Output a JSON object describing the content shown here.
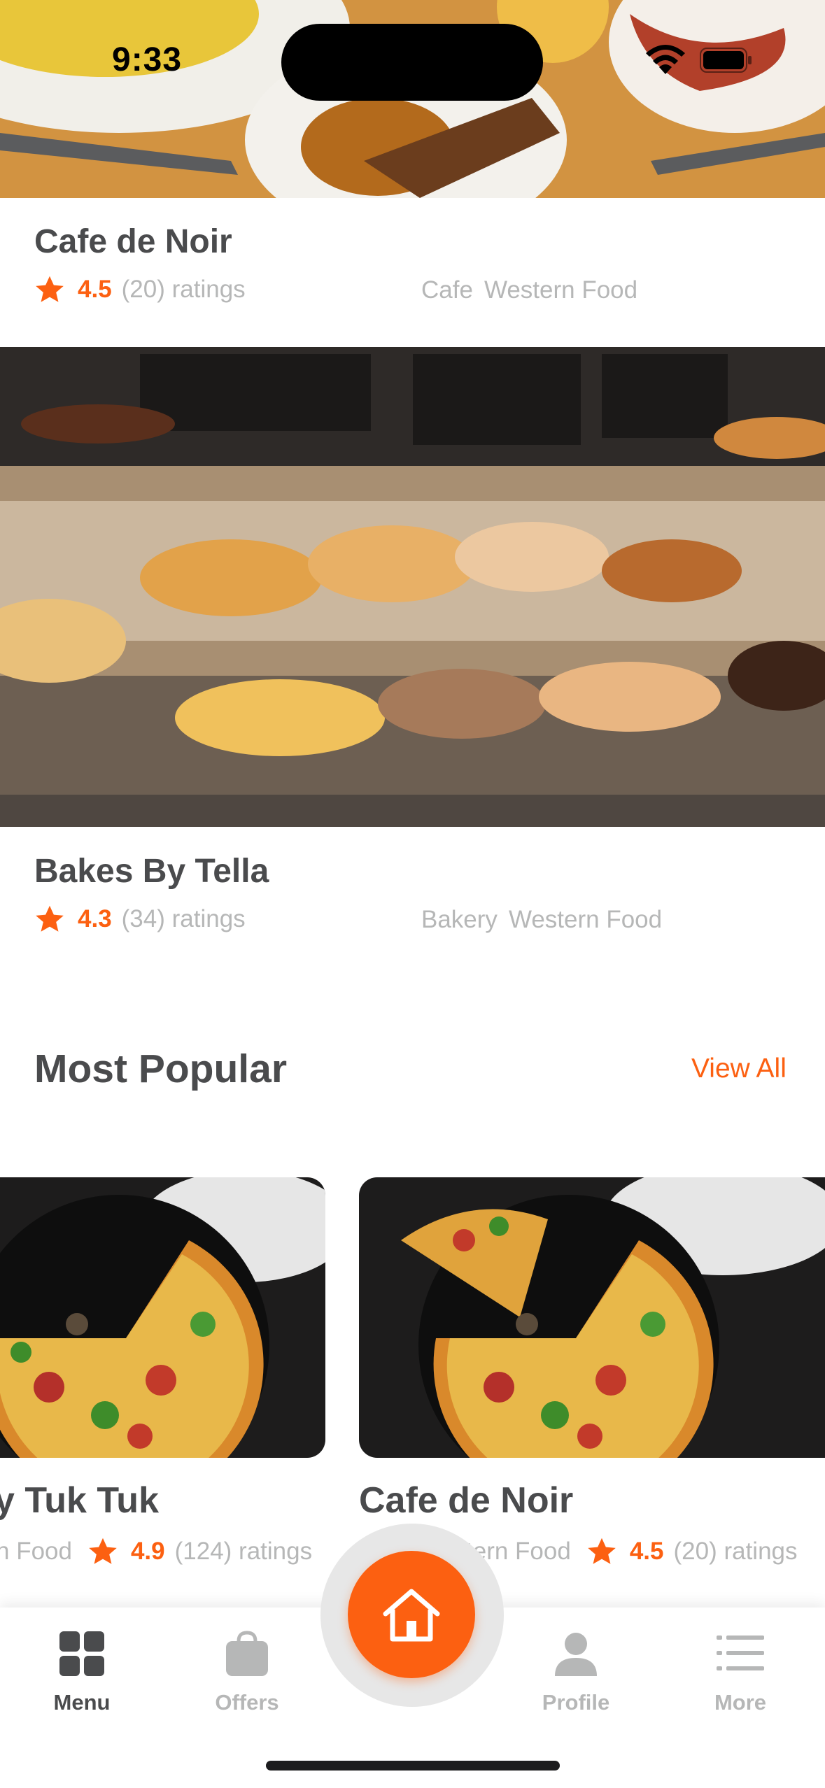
{
  "status_bar": {
    "time": "9:33"
  },
  "restaurants": [
    {
      "name": "Cafe de Noir",
      "rating": "4.5",
      "rating_count": "(20) ratings",
      "categories": [
        "Cafe",
        "Western Food"
      ]
    },
    {
      "name": "Bakes By Tella",
      "rating": "4.3",
      "rating_count": "(34) ratings",
      "categories": [
        "Bakery",
        "Western Food"
      ]
    }
  ],
  "most_popular": {
    "title": "Most Popular",
    "view_all": "View All",
    "items": [
      {
        "name": "y Tuk Tuk",
        "category": "n Food",
        "rating": "4.9",
        "rating_count": "(124) ratings"
      },
      {
        "name": "Cafe de Noir",
        "category": "Cafe  Western Food",
        "rating": "4.5",
        "rating_count": "(20) ratings"
      }
    ]
  },
  "tabbar": {
    "menu": "Menu",
    "offers": "Offers",
    "profile": "Profile",
    "more": "More"
  },
  "colors": {
    "accent": "#fc6011",
    "primary_text": "#4a4b4d",
    "secondary_text": "#b6b7b7"
  },
  "icons": [
    "star-icon",
    "grid-icon",
    "bag-icon",
    "home-icon",
    "person-icon",
    "list-icon",
    "wifi-icon",
    "battery-icon"
  ]
}
